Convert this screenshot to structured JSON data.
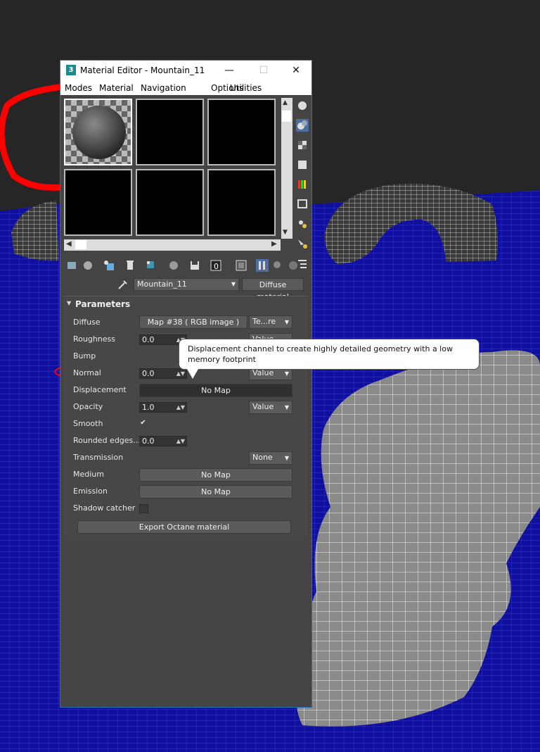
{
  "window": {
    "title": "Material Editor - Mountain_11",
    "app_icon_text": "3",
    "controls": {
      "minimize": "—",
      "maximize": "☐",
      "close": "✕"
    }
  },
  "menu": {
    "items": [
      "Modes",
      "Material",
      "Navigation",
      "Options",
      "Utilities"
    ]
  },
  "material_selector": {
    "name": "Mountain_11",
    "type_button": "Diffuse material"
  },
  "rollout": {
    "title": "Parameters",
    "collapse_glyph": "▼"
  },
  "params": {
    "diffuse": {
      "label": "Diffuse",
      "map_button": "Map #38 ( RGB image )",
      "mode": "Te...re"
    },
    "roughness": {
      "label": "Roughness",
      "value": "0.0",
      "mode": "Value"
    },
    "bump": {
      "label": "Bump"
    },
    "normal": {
      "label": "Normal",
      "value": "0.0",
      "mode": "Value"
    },
    "displacement": {
      "label": "Displacement",
      "map_button": "No Map"
    },
    "opacity": {
      "label": "Opacity",
      "value": "1.0",
      "mode": "Value"
    },
    "smooth": {
      "label": "Smooth",
      "checked_glyph": "✔"
    },
    "rounded_edges": {
      "label": "Rounded edges...",
      "value": "0.0"
    },
    "transmission": {
      "label": "Transmission",
      "mode": "None"
    },
    "medium": {
      "label": "Medium",
      "map_button": "No Map"
    },
    "emission": {
      "label": "Emission",
      "map_button": "No Map"
    },
    "shadow_catcher": {
      "label": "Shadow catcher"
    }
  },
  "export_button": "Export Octane material",
  "tooltip": {
    "text": "Displacement channel to create highly detailed geometry with a low memory footprint"
  },
  "colors": {
    "viewport_grid": "#1414a8",
    "annotation_red": "#ff0000",
    "panel_bg": "#444444"
  }
}
